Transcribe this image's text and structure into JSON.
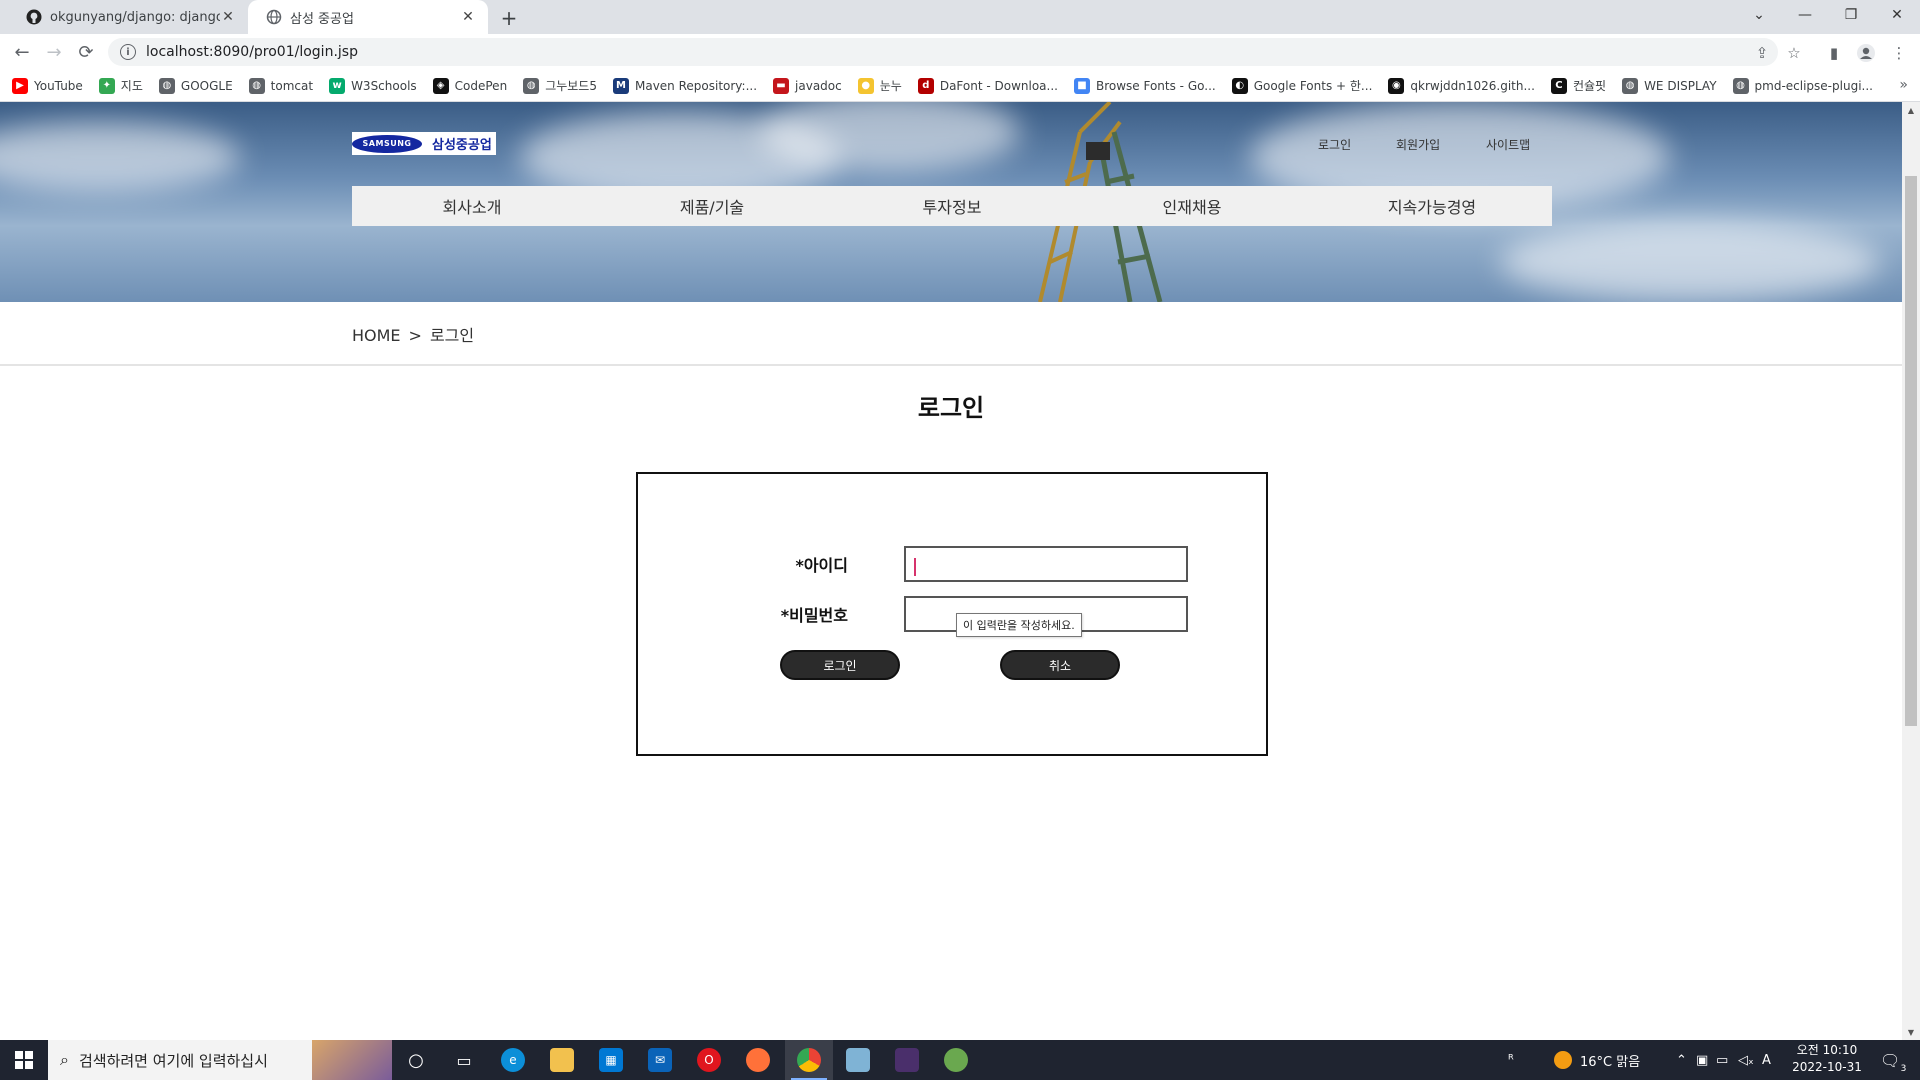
{
  "browser": {
    "tabs": [
      {
        "title": "okgunyang/django: django boo",
        "active": false
      },
      {
        "title": "삼성 중공업",
        "active": true
      }
    ],
    "address": "localhost:8090/pro01/login.jsp",
    "bookmarks": [
      {
        "label": "YouTube",
        "icon": "youtube-icon",
        "color": "#ff0000"
      },
      {
        "label": "지도",
        "icon": "maps-icon",
        "color": "#34a853"
      },
      {
        "label": "GOOGLE",
        "icon": "globe-icon",
        "color": "#5f6368"
      },
      {
        "label": "tomcat",
        "icon": "globe-icon",
        "color": "#5f6368"
      },
      {
        "label": "W3Schools",
        "icon": "w3schools-icon",
        "color": "#04aa6d"
      },
      {
        "label": "CodePen",
        "icon": "codepen-icon",
        "color": "#111111"
      },
      {
        "label": "그누보드5",
        "icon": "globe-icon",
        "color": "#5f6368"
      },
      {
        "label": "Maven Repository:...",
        "icon": "maven-icon",
        "color": "#1a3b7a"
      },
      {
        "label": "javadoc",
        "icon": "javadoc-icon",
        "color": "#c4161c"
      },
      {
        "label": "눈누",
        "icon": "noonnu-icon",
        "color": "#f4c430"
      },
      {
        "label": "DaFont - Downloa...",
        "icon": "dafont-icon",
        "color": "#b30000"
      },
      {
        "label": "Browse Fonts - Go...",
        "icon": "google-fonts-icon",
        "color": "#4285f4"
      },
      {
        "label": "Google Fonts + 한...",
        "icon": "google-fonts-kr-icon",
        "color": "#111111"
      },
      {
        "label": "qkrwjddn1026.gith...",
        "icon": "github-icon",
        "color": "#111111"
      },
      {
        "label": "컨슐핏",
        "icon": "consulfit-icon",
        "color": "#111111"
      },
      {
        "label": "WE DISPLAY",
        "icon": "globe-icon",
        "color": "#5f6368"
      },
      {
        "label": "pmd-eclipse-plugi...",
        "icon": "globe-icon",
        "color": "#5f6368"
      }
    ]
  },
  "site": {
    "logo_brand": "SAMSUNG",
    "logo_text": "삼성중공업",
    "util_links": [
      "로그인",
      "회원가입",
      "사이트맵"
    ],
    "gnb": [
      "회사소개",
      "제품/기술",
      "투자정보",
      "인재채용",
      "지속가능경영"
    ],
    "breadcrumb": {
      "home": "HOME",
      "sep": ">",
      "current": "로그인"
    },
    "page_title": "로그인",
    "form": {
      "id_label": "*아이디",
      "id_value": "",
      "pw_label": "*비밀번호",
      "pw_value": "",
      "tooltip": "이 입력란을 작성하세요.",
      "login_button": "로그인",
      "cancel_button": "취소"
    },
    "colors": {
      "brand": "#1428a0",
      "button": "#2b2b2b"
    }
  },
  "taskbar": {
    "search_placeholder": "검색하려면 여기에 입력하십시",
    "weather": "16°C  맑음",
    "time": "오전 10:10",
    "date": "2022-10-31",
    "notifications": "3",
    "ime": "A"
  }
}
